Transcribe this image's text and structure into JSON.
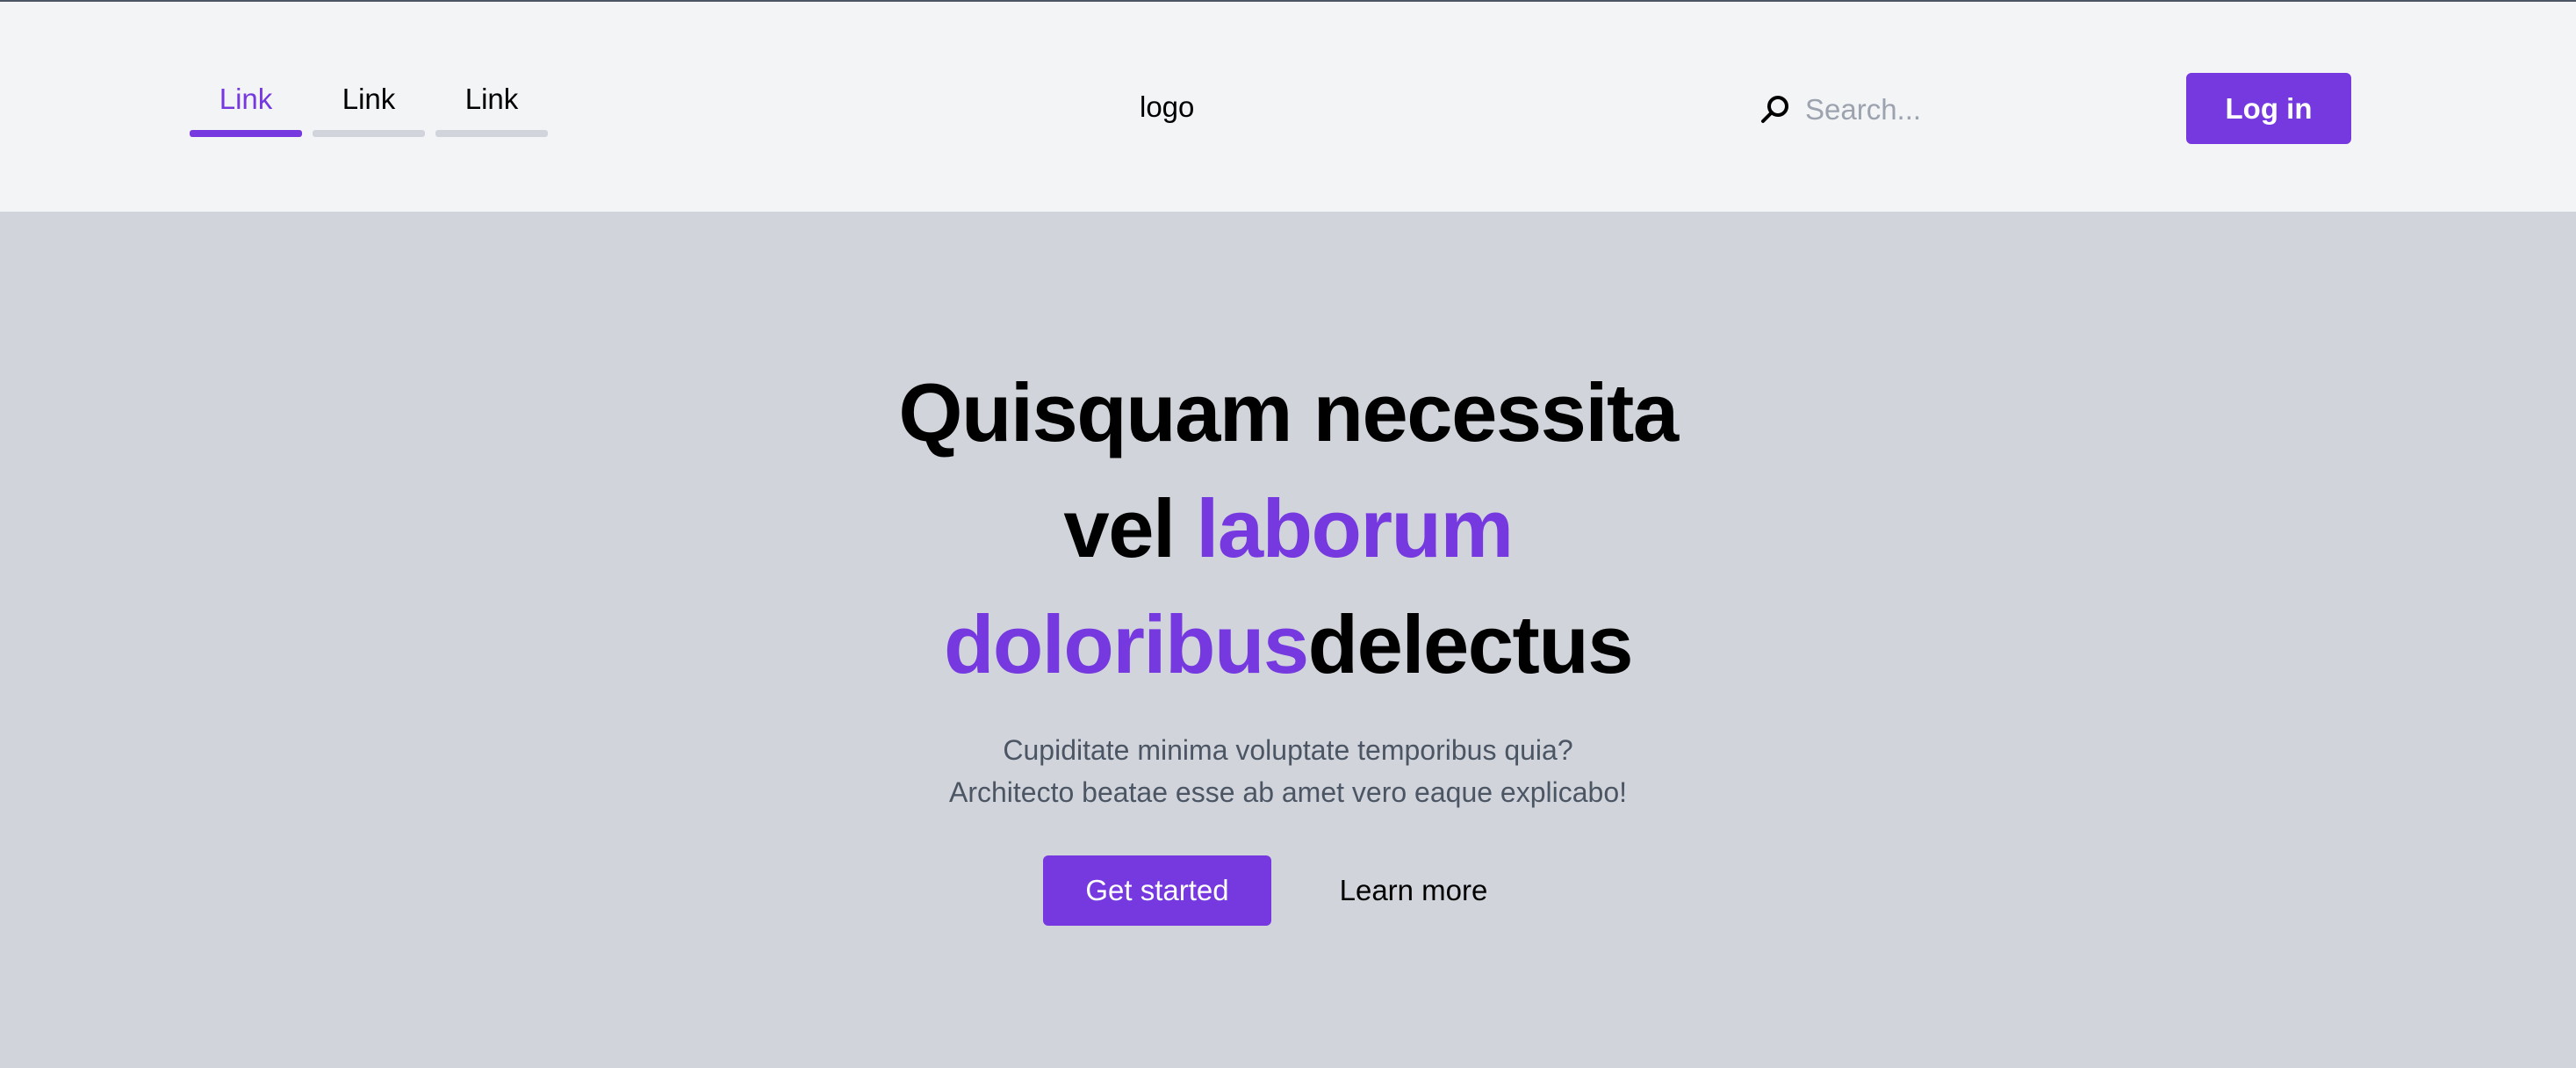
{
  "header": {
    "nav_links": [
      {
        "label": "Link",
        "active": true
      },
      {
        "label": "Link",
        "active": false
      },
      {
        "label": "Link",
        "active": false
      }
    ],
    "logo": "logo",
    "search": {
      "placeholder": "Search...",
      "value": "",
      "icon": "search-icon"
    },
    "login_label": "Log in"
  },
  "hero": {
    "title": {
      "line1": "Quisquam necessita",
      "line2_plain": "vel",
      "line2_accent": "laborum",
      "line3_accent": "doloribus",
      "line3_plain": "delectus"
    },
    "subtitle": {
      "line1": "Cupiditate minima voluptate temporibus quia?",
      "line2": "Architecto beatae esse ab amet vero eaque explicabo!"
    },
    "cta_label": "Get started",
    "secondary_label": "Learn more"
  },
  "colors": {
    "accent": "#7639e0",
    "header_bg": "#f3f4f6",
    "hero_bg": "#d1d5db",
    "muted_text": "#4b5563"
  }
}
